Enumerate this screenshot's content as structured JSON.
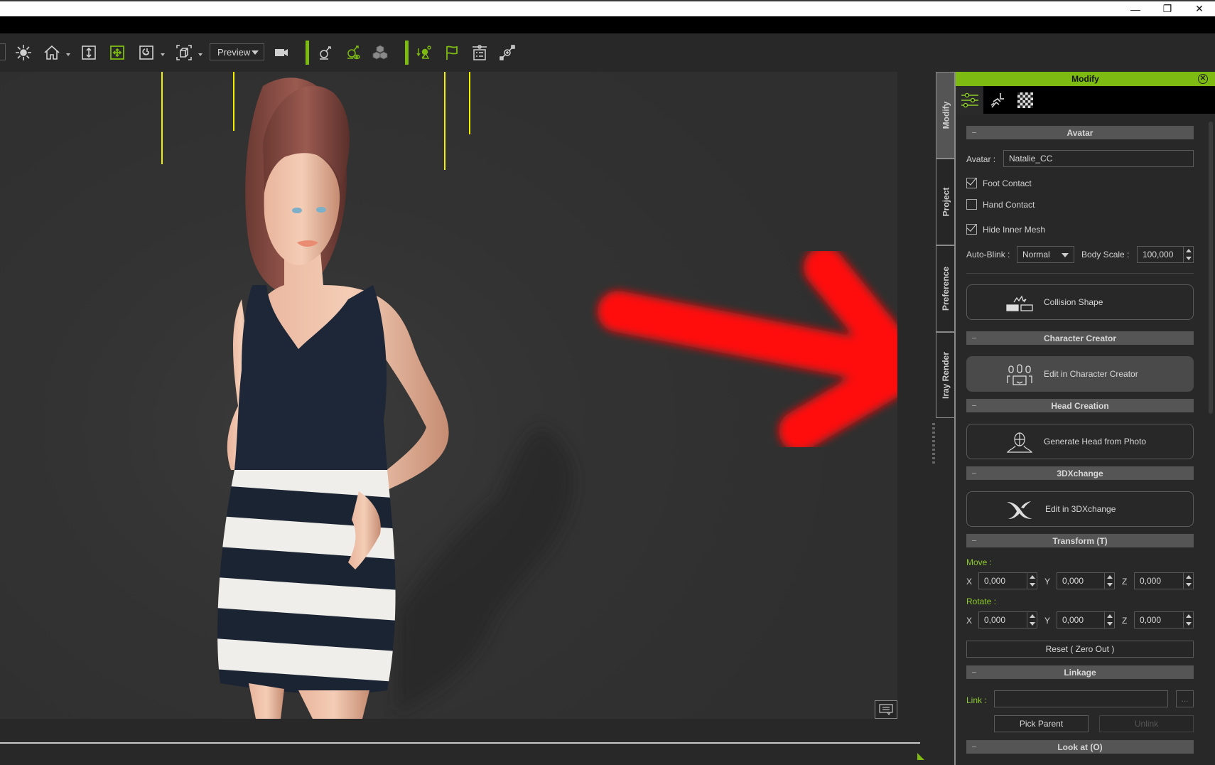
{
  "window": {
    "minimize_glyph": "—",
    "maximize_glyph": "❐",
    "close_glyph": "✕"
  },
  "toolbar": {
    "icons": [
      "sun-light-icon",
      "home-camera-icon",
      "fit-vertical-icon",
      "move-gizmo-icon",
      "rotate-view-icon",
      "frame-box-icon",
      "camera-icon",
      "motion-pick-icon",
      "motion-view-icon",
      "cubes-icon",
      "physics-icon",
      "flag-icon",
      "properties-list-icon",
      "link-edit-icon"
    ],
    "preview_dropdown": {
      "selected": "Preview"
    }
  },
  "side_tabs": [
    {
      "label": "Modify",
      "active": true
    },
    {
      "label": "Project",
      "active": false
    },
    {
      "label": "Preference",
      "active": false
    },
    {
      "label": "Iray Render",
      "active": false
    }
  ],
  "panel": {
    "title": "Modify",
    "close_glyph": "⊗",
    "icon_tabs": [
      "sliders-icon",
      "motion-run-icon",
      "checker-material-icon"
    ],
    "sections": {
      "avatar": {
        "title": "Avatar",
        "avatar_label": "Avatar :",
        "avatar_value": "Natalie_CC",
        "foot_contact": {
          "label": "Foot Contact",
          "checked": true
        },
        "hand_contact": {
          "label": "Hand Contact",
          "checked": false
        },
        "hide_inner_mesh": {
          "label": "Hide Inner Mesh",
          "checked": true
        },
        "auto_blink_label": "Auto-Blink :",
        "auto_blink_value": "Normal",
        "body_scale_label": "Body Scale :",
        "body_scale_value": "100,000",
        "collision_button": "Collision Shape"
      },
      "character_creator": {
        "title": "Character Creator",
        "button": "Edit in Character Creator"
      },
      "head_creation": {
        "title": "Head Creation",
        "button": "Generate Head from Photo"
      },
      "three_d_xchange": {
        "title": "3DXchange",
        "button": "Edit in 3DXchange"
      },
      "transform": {
        "title": "Transform  (T)",
        "move_label": "Move :",
        "rotate_label": "Rotate :",
        "axis_x": "X",
        "axis_y": "Y",
        "axis_z": "Z",
        "move": {
          "x": "0,000",
          "y": "0,000",
          "z": "0,000"
        },
        "rotate": {
          "x": "0,000",
          "y": "0,000",
          "z": "0,000"
        },
        "reset_button": "Reset ( Zero Out )"
      },
      "linkage": {
        "title": "Linkage",
        "link_label": "Link :",
        "link_value": "",
        "browse_glyph": "...",
        "pick_parent_button": "Pick Parent",
        "unlink_button": "Unlink"
      },
      "look_at": {
        "title": "Look at  (O)"
      }
    }
  },
  "colors": {
    "accent": "#7dbb12",
    "annotation_arrow": "#ff0000",
    "panel_bg": "#282828",
    "section_header": "#555555"
  }
}
